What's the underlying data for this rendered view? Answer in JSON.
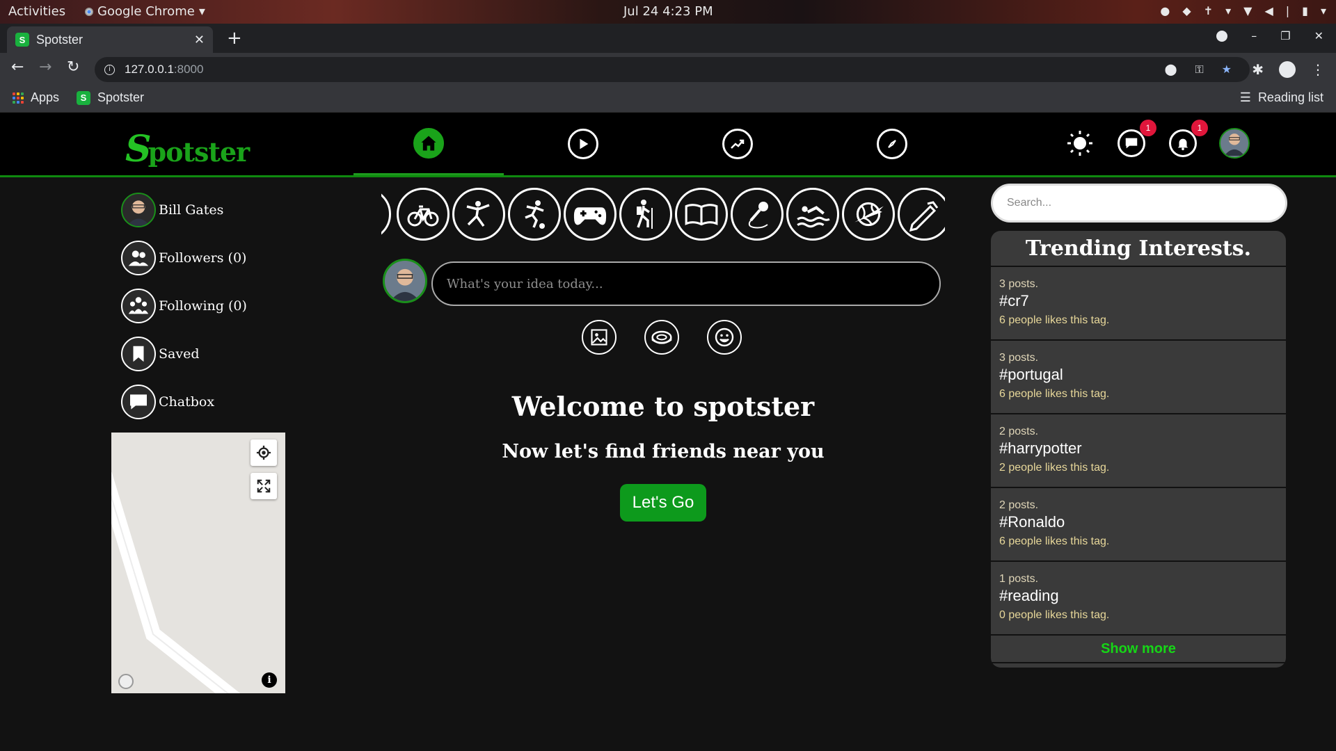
{
  "os": {
    "activities": "Activities",
    "app_name": "Google Chrome",
    "clock": "Jul 24  4:23 PM"
  },
  "browser": {
    "tab_title": "Spotster",
    "url_host": "127.0.0.1",
    "url_port": ":8000",
    "bookmarks": [
      {
        "label": "Apps",
        "icon": "apps-grid-icon"
      },
      {
        "label": "Spotster",
        "icon": "spotster-favicon"
      }
    ],
    "reading_list": "Reading list"
  },
  "site": {
    "logo_mark": "S",
    "logo_text": "potster",
    "nav": [
      {
        "name": "home",
        "icon": "home-icon",
        "active": true
      },
      {
        "name": "videos",
        "icon": "play-icon",
        "active": false
      },
      {
        "name": "trending",
        "icon": "trending-icon",
        "active": false
      },
      {
        "name": "explore",
        "icon": "compass-icon",
        "active": false
      }
    ],
    "messages_badge": "1",
    "notifications_badge": "1",
    "accent_color": "#1aa31a"
  },
  "sidebar": {
    "user_name": "Bill Gates",
    "items": [
      {
        "label": "Followers (0)",
        "icon": "followers-icon"
      },
      {
        "label": "Following (0)",
        "icon": "following-icon"
      },
      {
        "label": "Saved",
        "icon": "bookmark-icon"
      },
      {
        "label": "Chatbox",
        "icon": "chat-icon"
      }
    ]
  },
  "interests": [
    "cycling",
    "ballet",
    "soccer",
    "gaming",
    "hiking",
    "reading",
    "singing",
    "swimming",
    "travel",
    "drawing"
  ],
  "composer": {
    "placeholder": "What's your idea today...",
    "attachments": [
      "image-icon",
      "stadium-icon",
      "emoji-icon"
    ]
  },
  "main": {
    "welcome": "Welcome to spotster",
    "subtitle": "Now let's find friends near you",
    "cta": "Let's Go"
  },
  "search": {
    "placeholder": "Search..."
  },
  "trending": {
    "title": "Trending Interests.",
    "items": [
      {
        "posts": "3 posts.",
        "tag": "#cr7",
        "likes": "6 people likes this tag."
      },
      {
        "posts": "3 posts.",
        "tag": "#portugal",
        "likes": "6 people likes this tag."
      },
      {
        "posts": "2 posts.",
        "tag": "#harrypotter",
        "likes": "2 people likes this tag."
      },
      {
        "posts": "2 posts.",
        "tag": "#Ronaldo",
        "likes": "6 people likes this tag."
      },
      {
        "posts": "1 posts.",
        "tag": "#reading",
        "likes": "0 people likes this tag."
      }
    ],
    "show_more": "Show more"
  }
}
